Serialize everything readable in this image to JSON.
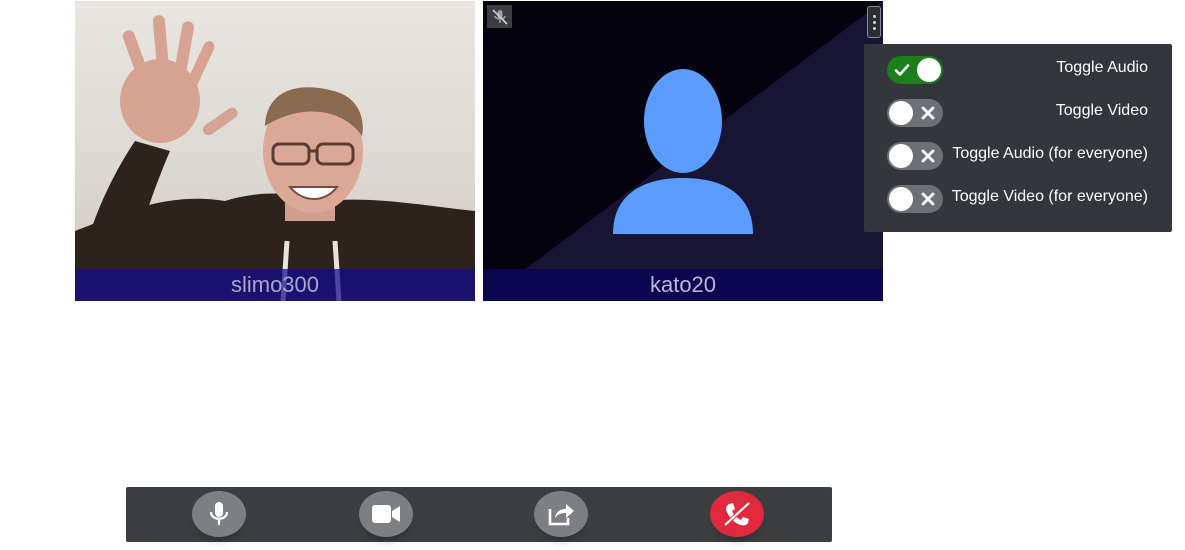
{
  "participants": {
    "local": {
      "name": "slimo300"
    },
    "remote": {
      "name": "kato20"
    }
  },
  "tile_menu": {
    "items": [
      {
        "label": "Toggle Audio",
        "state": "on"
      },
      {
        "label": "Toggle Video",
        "state": "off"
      },
      {
        "label": "Toggle Audio (for everyone)",
        "state": "off"
      },
      {
        "label": "Toggle Video (for everyone)",
        "state": "off"
      }
    ]
  },
  "controls": {
    "buttons": [
      {
        "name": "microphone",
        "icon": "microphone-icon"
      },
      {
        "name": "camera",
        "icon": "video-camera-icon"
      },
      {
        "name": "share",
        "icon": "share-icon"
      },
      {
        "name": "hang-up",
        "icon": "phone-slash-icon"
      }
    ]
  },
  "colors": {
    "name_bar": "#140a8c",
    "switch_on": "#1b7f1b",
    "switch_off": "#6c7178",
    "avatar": "#5b9cff",
    "hangup": "#e1293d",
    "control_button": "#7e7f82",
    "menu_bg": "#33373d"
  }
}
